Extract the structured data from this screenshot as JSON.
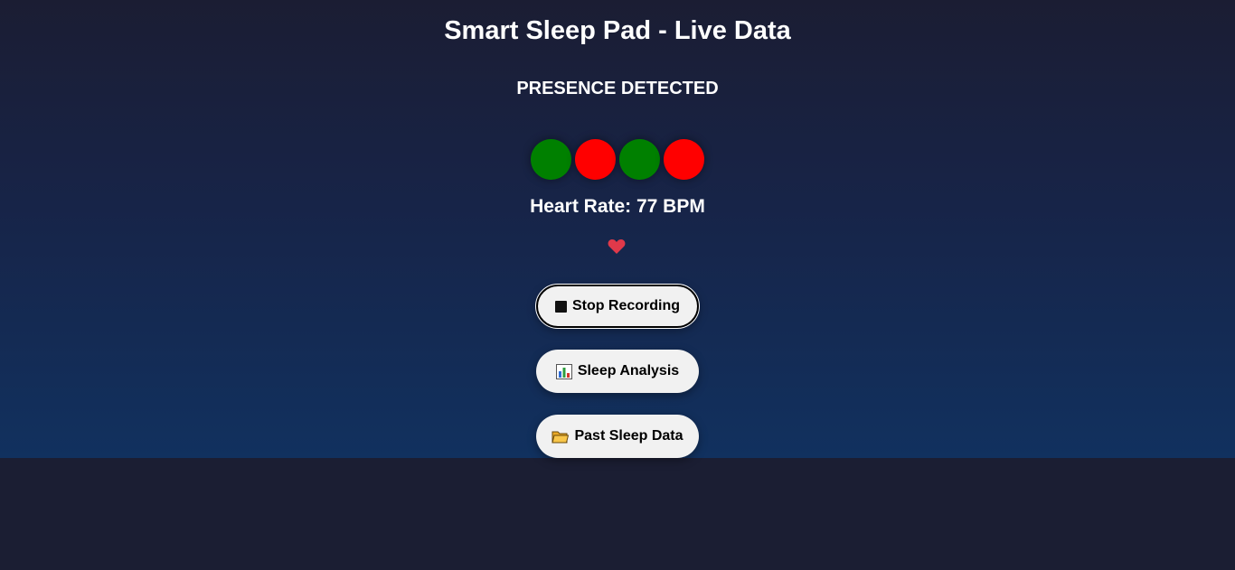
{
  "header": {
    "title": "Smart Sleep Pad - Live Data"
  },
  "presence": {
    "status_text": "PRESENCE DETECTED"
  },
  "sensors": {
    "states": [
      "active",
      "inactive",
      "active",
      "inactive"
    ],
    "colors": {
      "active": "#008000",
      "inactive": "#ff0000"
    }
  },
  "vitals": {
    "heart_rate_text": "Heart Rate: 77 BPM",
    "heart_icon": "heart-icon",
    "heart_color": "#e0394a"
  },
  "actions": {
    "stop_recording": {
      "label": "Stop Recording",
      "icon": "stop-icon"
    },
    "sleep_analysis": {
      "label": "Sleep Analysis",
      "icon": "bar-chart-icon"
    },
    "past_sleep_data": {
      "label": "Past Sleep Data",
      "icon": "folder-icon"
    }
  },
  "theme": {
    "page_bottom": "#1b1e33",
    "button_bg": "#f1f1f1"
  }
}
